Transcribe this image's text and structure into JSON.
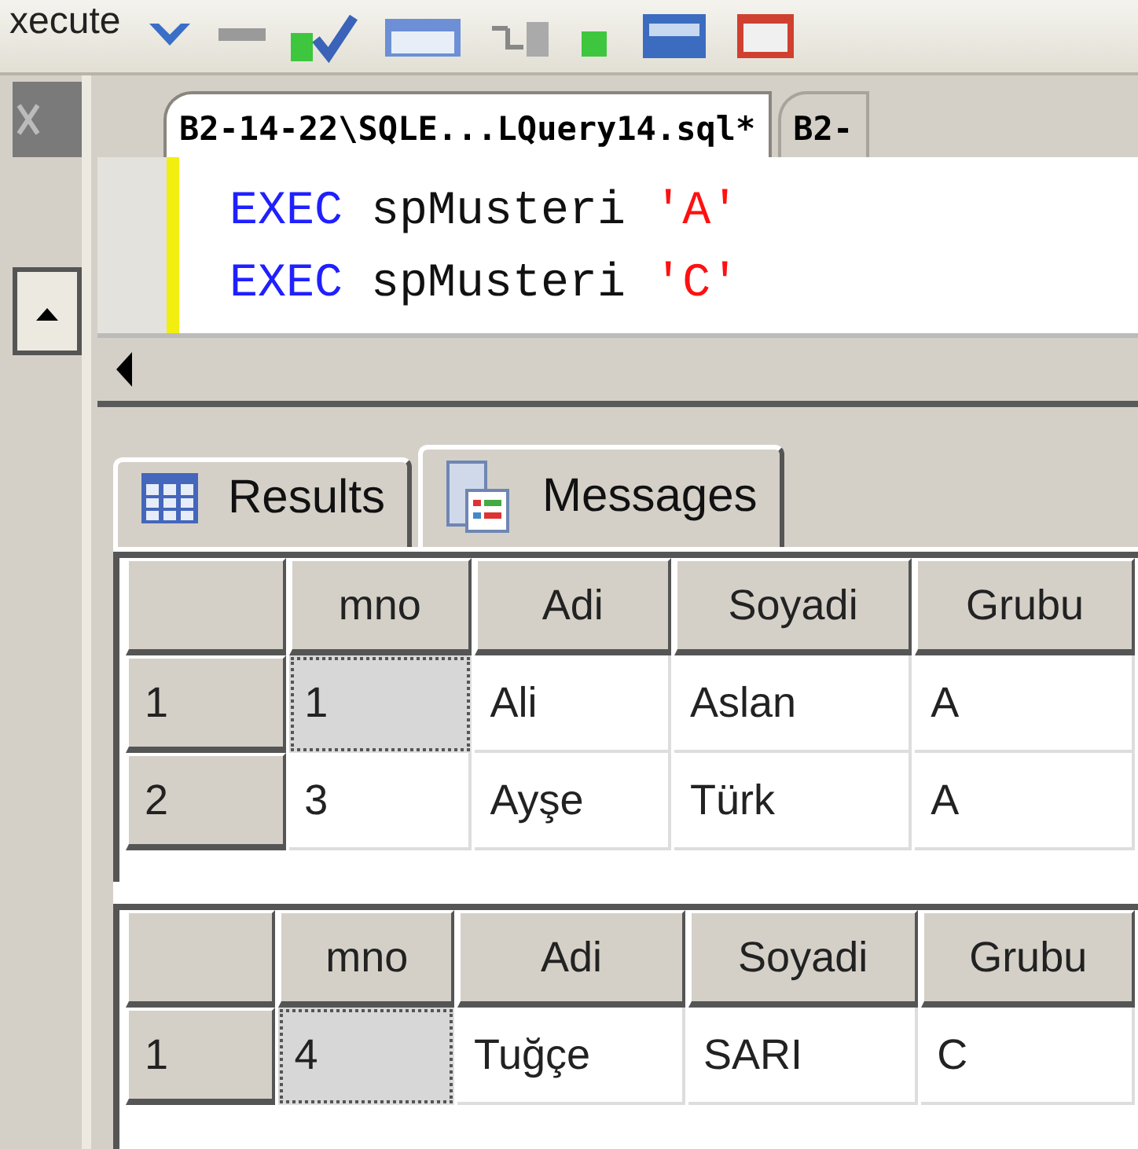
{
  "toolbar": {
    "label": "xecute"
  },
  "editor_tabs": [
    {
      "label": "B2-14-22\\SQLE...LQuery14.sql*",
      "selected": true
    },
    {
      "label": "B2-",
      "selected": false
    }
  ],
  "code_lines": [
    [
      {
        "kind": "keyword",
        "text": "EXEC"
      },
      {
        "kind": "plain",
        "text": "spMusteri"
      },
      {
        "kind": "string",
        "text": "'A'"
      }
    ],
    [
      {
        "kind": "keyword",
        "text": "EXEC"
      },
      {
        "kind": "plain",
        "text": "spMusteri"
      },
      {
        "kind": "string",
        "text": "'C'"
      }
    ]
  ],
  "result_tabs": [
    {
      "label": "Results",
      "kind": "grid",
      "selected": true
    },
    {
      "label": "Messages",
      "kind": "messages",
      "selected": false
    }
  ],
  "grids": [
    {
      "columns": [
        "mno",
        "Adi",
        "Soyadi",
        "Grubu"
      ],
      "rows": [
        {
          "number": "1",
          "cells": [
            {
              "text": "1",
              "selected": true
            },
            {
              "text": "Ali",
              "selected": false
            },
            {
              "text": "Aslan",
              "selected": false
            },
            {
              "text": "A",
              "selected": false
            }
          ]
        },
        {
          "number": "2",
          "cells": [
            {
              "text": "3",
              "selected": false
            },
            {
              "text": "Ayşe",
              "selected": false
            },
            {
              "text": "Türk",
              "selected": false
            },
            {
              "text": "A",
              "selected": false
            }
          ]
        }
      ]
    },
    {
      "columns": [
        "mno",
        "Adi",
        "Soyadi",
        "Grubu"
      ],
      "rows": [
        {
          "number": "1",
          "cells": [
            {
              "text": "4",
              "selected": true
            },
            {
              "text": "Tuğçe",
              "selected": false
            },
            {
              "text": "SARI",
              "selected": false
            },
            {
              "text": "C",
              "selected": false
            }
          ]
        }
      ]
    }
  ]
}
